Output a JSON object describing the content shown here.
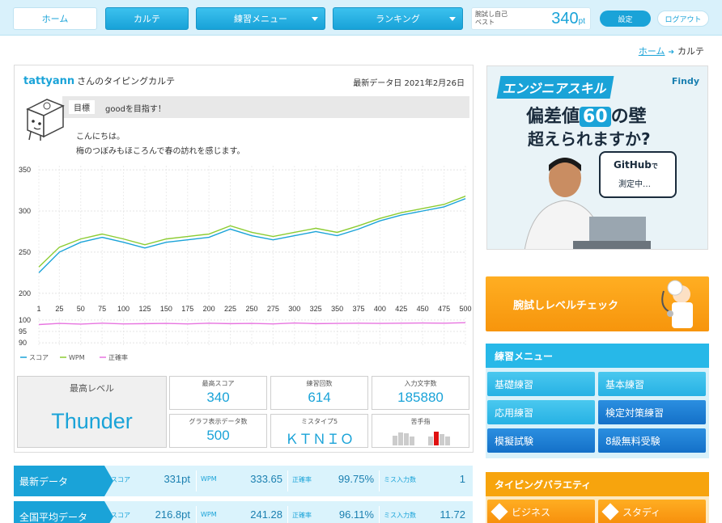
{
  "nav": {
    "home": "ホーム",
    "karte": "カルテ",
    "practice_menu": "練習メニュー",
    "ranking": "ランキング",
    "best_label": "腕試し自己ベスト",
    "best_value": "340",
    "best_unit": "pt",
    "settings": "設定",
    "logout": "ログアウト"
  },
  "breadcrumb": {
    "home": "ホーム",
    "current": "カルテ"
  },
  "karte": {
    "username": "tattyann",
    "title_suffix": "さんのタイピングカルテ",
    "latest_date": "最新データ日 2021年2月26日",
    "goal_tag": "目標",
    "goal_text": "goodを目指す！",
    "message_line1": "こんにちは。",
    "message_line2": "梅のつぼみもほころんで春の訪れを感じます。"
  },
  "chart_data": {
    "type": "line",
    "title": "",
    "x_ticks": [
      1,
      25,
      50,
      75,
      100,
      125,
      150,
      175,
      200,
      225,
      250,
      275,
      300,
      325,
      350,
      375,
      400,
      425,
      450,
      475,
      500
    ],
    "upper_y_ticks": [
      200,
      250,
      300,
      350
    ],
    "upper_ylim": [
      190,
      355
    ],
    "lower_y_ticks": [
      90,
      95,
      100
    ],
    "lower_ylim": [
      89,
      101
    ],
    "xlim": [
      1,
      500
    ],
    "grid": true,
    "legend_position": "bottom-left",
    "series": [
      {
        "name": "スコア",
        "color": "#1aa3d8",
        "panel": "upper",
        "x": [
          1,
          25,
          50,
          75,
          100,
          125,
          150,
          175,
          200,
          225,
          250,
          275,
          300,
          325,
          350,
          375,
          400,
          425,
          450,
          475,
          500
        ],
        "y": [
          225,
          250,
          262,
          268,
          262,
          255,
          262,
          265,
          268,
          278,
          270,
          265,
          270,
          275,
          270,
          278,
          288,
          295,
          300,
          305,
          315
        ]
      },
      {
        "name": "WPM",
        "color": "#8ccc32",
        "panel": "upper",
        "x": [
          1,
          25,
          50,
          75,
          100,
          125,
          150,
          175,
          200,
          225,
          250,
          275,
          300,
          325,
          350,
          375,
          400,
          425,
          450,
          475,
          500
        ],
        "y": [
          232,
          256,
          266,
          272,
          266,
          259,
          266,
          269,
          272,
          282,
          274,
          269,
          274,
          279,
          274,
          282,
          291,
          298,
          303,
          308,
          318
        ]
      },
      {
        "name": "正確率",
        "color": "#e774e0",
        "panel": "lower",
        "x": [
          1,
          25,
          50,
          75,
          100,
          125,
          150,
          175,
          200,
          225,
          250,
          275,
          300,
          325,
          350,
          375,
          400,
          425,
          450,
          475,
          500
        ],
        "y": [
          98,
          98.5,
          98.2,
          98.6,
          98.3,
          98.4,
          98.5,
          98.3,
          98.6,
          98.4,
          98.5,
          98.3,
          98.7,
          98.4,
          98.5,
          98.6,
          98.5,
          98.6,
          98.7,
          98.6,
          98.8
        ]
      }
    ]
  },
  "stats": {
    "max_level_label": "最高レベル",
    "max_level": "Thunder",
    "best_score_label": "最高スコア",
    "best_score": "340",
    "practice_count_label": "練習回数",
    "practice_count": "614",
    "input_chars_label": "入力文字数",
    "input_chars": "185880",
    "graph_data_label": "グラフ表示データ数",
    "graph_data": "500",
    "miss_top5_label": "ミスタイプ5",
    "miss_top5": "ＫＴＮＩＯ",
    "weak_finger_label": "苦手指"
  },
  "rows": {
    "labels": {
      "score": "スコア",
      "wpm": "WPM",
      "accuracy": "正確率",
      "miss": "ミス入力数"
    },
    "latest": {
      "title": "最新データ",
      "score": "331pt",
      "wpm": "333.65",
      "accuracy": "99.75%",
      "miss": "1"
    },
    "average": {
      "title": "全国平均データ",
      "score": "216.8pt",
      "wpm": "241.28",
      "accuracy": "96.11%",
      "miss": "11.72"
    }
  },
  "ad": {
    "banner": "エンジニアスキル",
    "logo": "Findy",
    "line2_pre": "偏差値",
    "line2_num": "60",
    "line2_post": "の壁",
    "line3": "超えられますか?",
    "bubble_main": "GitHub",
    "bubble_de": "で",
    "bubble_sub": "測定中…"
  },
  "sidebar": {
    "level_check": "腕試しレベルチェック",
    "practice_title": "練習メニュー",
    "practice_items": [
      "基礎練習",
      "基本練習",
      "応用練習",
      "検定対策練習",
      "模擬試験",
      "8級無料受験"
    ],
    "variety_title": "タイピングバラエティ",
    "variety_items": [
      "ビジネス",
      "スタディ"
    ]
  },
  "colors": {
    "accent": "#1aa3d8",
    "orange": "#f7a40d",
    "score": "#1aa3d8",
    "wpm": "#8ccc32",
    "accuracy": "#e774e0"
  }
}
